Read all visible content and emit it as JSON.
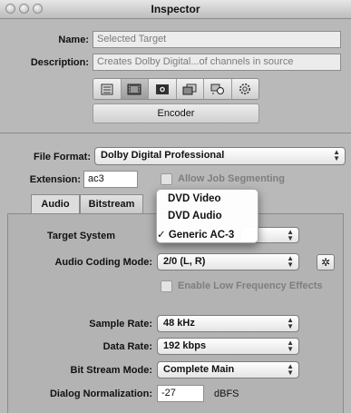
{
  "window": {
    "title": "Inspector"
  },
  "fields": {
    "name_label": "Name:",
    "name_value": "Selected Target",
    "description_label": "Description:",
    "description_value": "Creates Dolby Digital...of channels in source"
  },
  "toolbar": {
    "icons": [
      "summary-icon",
      "video-icon",
      "encoder-icon",
      "filters-icon",
      "geometry-icon",
      "actions-icon"
    ],
    "encoder_label": "Encoder"
  },
  "format": {
    "file_format_label": "File Format:",
    "file_format_value": "Dolby Digital Professional",
    "extension_label": "Extension:",
    "extension_value": "ac3",
    "allow_segmenting_label": "Allow Job Segmenting"
  },
  "tabs": [
    "Audio",
    "Bitstream"
  ],
  "audio": {
    "target_system_label": "Target System",
    "coding_mode_label": "Audio Coding Mode:",
    "coding_mode_value": "2/0 (L, R)",
    "lfe_label": "Enable Low Frequency Effects",
    "sample_rate_label": "Sample Rate:",
    "sample_rate_value": "48 kHz",
    "data_rate_label": "Data Rate:",
    "data_rate_value": "192 kbps",
    "bitstream_mode_label": "Bit Stream Mode:",
    "bitstream_mode_value": "Complete Main",
    "dialog_norm_label": "Dialog Normalization:",
    "dialog_norm_value": "-27",
    "dialog_norm_unit": "dBFS"
  },
  "target_menu": {
    "items": [
      "DVD Video",
      "DVD Audio",
      "Generic AC-3"
    ],
    "checked_mark": "✓"
  }
}
